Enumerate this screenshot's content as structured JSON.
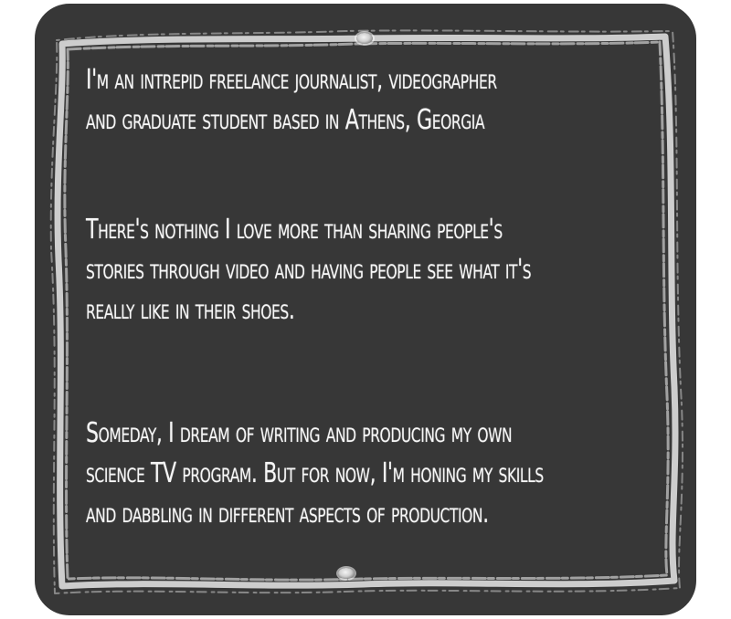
{
  "paragraphs": [
    {
      "lines": [
        "I'm an intrepid freelance journalist, videographer",
        "and graduate student  based in Athens, Georgia"
      ]
    },
    {
      "lines": [
        "There's nothing I love more than sharing people's",
        "stories through video and having people see what it's",
        "really like in their shoes."
      ]
    },
    {
      "lines": [
        "Someday, I dream of writing and producing my own",
        "science TV program.  But for now, I'm honing my skills",
        "and dabbling in different aspects of production."
      ]
    }
  ],
  "colors": {
    "board": "#373737",
    "chalk": "#f6f6f6",
    "background": "#ffffff"
  }
}
